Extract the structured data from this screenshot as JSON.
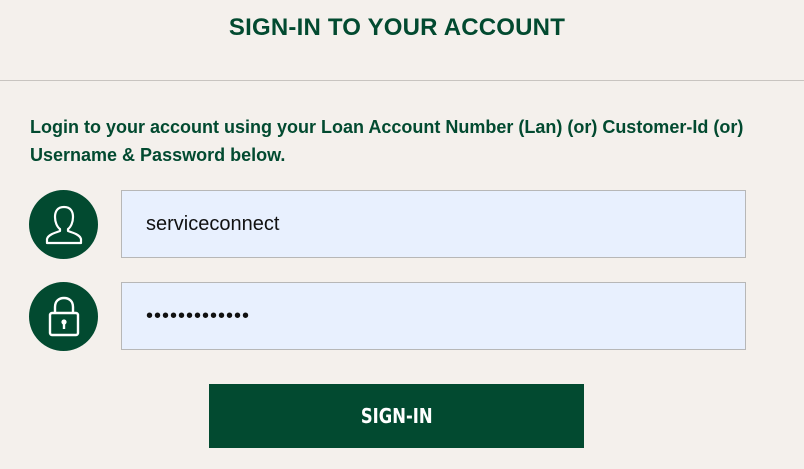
{
  "header": {
    "title": "SIGN-IN TO YOUR ACCOUNT"
  },
  "form": {
    "instructions": "Login to your account using your Loan Account Number (Lan) (or) Customer-Id (or) Username & Password below.",
    "username": {
      "value": "serviceconnect",
      "icon": "user-icon"
    },
    "password": {
      "value": "•••••••••••••",
      "icon": "lock-icon"
    },
    "submit_label": "SIGN-IN"
  },
  "colors": {
    "brand": "#024a30",
    "background": "#f4f0ec",
    "input_bg": "#e8f0fe"
  }
}
